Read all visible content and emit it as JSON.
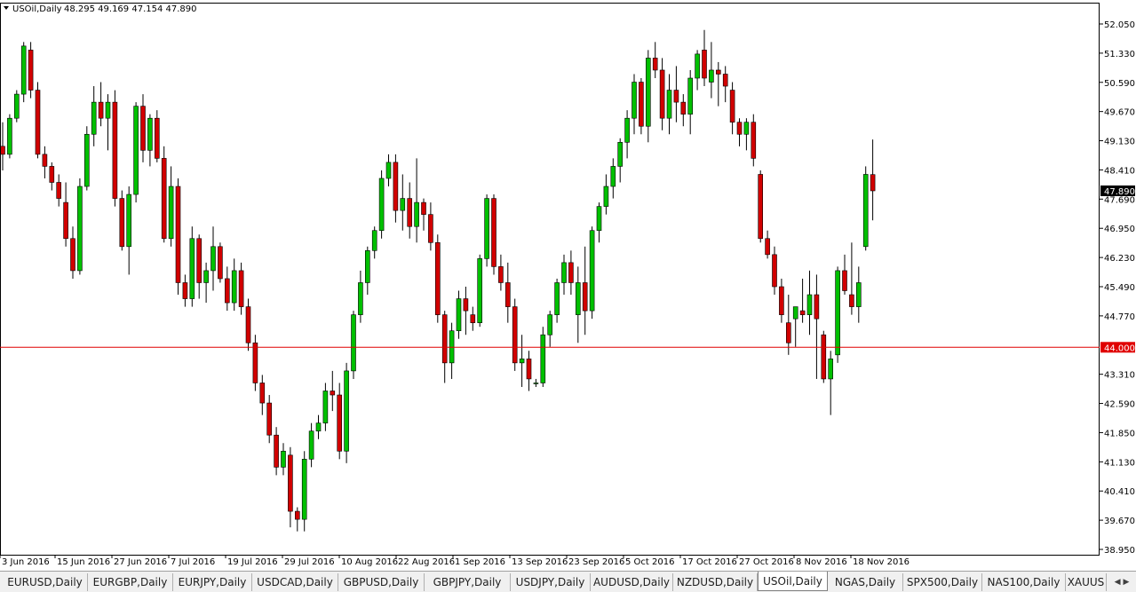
{
  "header": {
    "symbol": "USOil,Daily",
    "ohlc": "48.295 49.169 47.154 47.890"
  },
  "colors": {
    "bull": "#00c000",
    "bear": "#d10000",
    "wick": "#000000",
    "level_line": "#e00000",
    "price_tag_bg": "#000000",
    "level_tag_bg": "#e00000"
  },
  "chart_data": {
    "type": "candlestick",
    "title": "USOil,Daily",
    "y_ticks": [
      "52.050",
      "51.330",
      "50.590",
      "49.670",
      "49.130",
      "48.410",
      "47.690",
      "46.950",
      "46.230",
      "45.490",
      "44.770",
      "44.000",
      "43.310",
      "42.590",
      "41.850",
      "41.130",
      "40.410",
      "39.670",
      "38.950"
    ],
    "x_labels": [
      "3 Jun 2016",
      "15 Jun 2016",
      "27 Jun 2016",
      "7 Jul 2016",
      "19 Jul 2016",
      "29 Jul 2016",
      "10 Aug 2016",
      "22 Aug 2016",
      "1 Sep 2016",
      "13 Sep 2016",
      "23 Sep 2016",
      "5 Oct 2016",
      "17 Oct 2016",
      "27 Oct 2016",
      "8 Nov 2016",
      "18 Nov 2016"
    ],
    "ylim": [
      38.8,
      52.3
    ],
    "horizontal_line": {
      "value": 44.0,
      "label": "44.000"
    },
    "current_price": {
      "value": 47.89,
      "label": "47.890"
    },
    "candles": [
      [
        49.0,
        49.6,
        48.4,
        48.8
      ],
      [
        48.8,
        49.8,
        48.7,
        49.7
      ],
      [
        49.7,
        50.4,
        49.6,
        50.3
      ],
      [
        50.3,
        51.6,
        50.1,
        51.5
      ],
      [
        51.4,
        51.6,
        50.2,
        50.4
      ],
      [
        50.4,
        50.6,
        48.7,
        48.8
      ],
      [
        48.8,
        49.0,
        48.2,
        48.5
      ],
      [
        48.5,
        48.6,
        47.9,
        48.1
      ],
      [
        48.1,
        48.3,
        47.5,
        47.7
      ],
      [
        47.6,
        48.1,
        46.5,
        46.7
      ],
      [
        46.7,
        47.0,
        45.7,
        45.9
      ],
      [
        45.9,
        48.2,
        45.8,
        48.0
      ],
      [
        48.0,
        49.5,
        47.9,
        49.3
      ],
      [
        49.3,
        50.5,
        49.0,
        50.1
      ],
      [
        50.1,
        50.6,
        49.5,
        49.7
      ],
      [
        49.7,
        50.3,
        48.9,
        50.1
      ],
      [
        50.1,
        50.4,
        47.5,
        47.7
      ],
      [
        47.7,
        47.9,
        46.4,
        46.5
      ],
      [
        46.5,
        48.0,
        45.8,
        47.8
      ],
      [
        47.8,
        50.1,
        47.6,
        50.0
      ],
      [
        50.0,
        50.3,
        48.6,
        48.9
      ],
      [
        48.9,
        49.8,
        48.5,
        49.7
      ],
      [
        49.7,
        49.9,
        48.6,
        48.7
      ],
      [
        48.7,
        49.0,
        46.6,
        46.7
      ],
      [
        46.7,
        48.5,
        46.5,
        48.0
      ],
      [
        48.0,
        48.2,
        45.3,
        45.6
      ],
      [
        45.6,
        45.8,
        45.0,
        45.2
      ],
      [
        45.2,
        47.0,
        45.0,
        46.7
      ],
      [
        46.7,
        46.8,
        45.2,
        45.6
      ],
      [
        45.6,
        46.1,
        45.1,
        45.9
      ],
      [
        45.9,
        47.0,
        45.4,
        46.5
      ],
      [
        46.5,
        46.6,
        45.6,
        45.7
      ],
      [
        45.7,
        46.0,
        44.9,
        45.1
      ],
      [
        45.1,
        46.2,
        44.9,
        45.9
      ],
      [
        45.9,
        46.1,
        44.8,
        45.0
      ],
      [
        45.0,
        45.2,
        43.9,
        44.1
      ],
      [
        44.1,
        44.3,
        42.9,
        43.1
      ],
      [
        43.1,
        43.3,
        42.3,
        42.6
      ],
      [
        42.6,
        42.8,
        41.6,
        41.8
      ],
      [
        41.8,
        42.0,
        40.8,
        41.0
      ],
      [
        41.0,
        41.6,
        40.8,
        41.4
      ],
      [
        41.3,
        41.5,
        39.5,
        39.9
      ],
      [
        39.9,
        40.0,
        39.4,
        39.7
      ],
      [
        39.7,
        41.4,
        39.4,
        41.2
      ],
      [
        41.2,
        42.1,
        41.0,
        41.9
      ],
      [
        41.9,
        42.3,
        41.7,
        42.1
      ],
      [
        42.1,
        43.1,
        41.9,
        42.9
      ],
      [
        42.9,
        43.4,
        42.4,
        42.8
      ],
      [
        42.8,
        43.1,
        41.2,
        41.4
      ],
      [
        41.4,
        43.6,
        41.1,
        43.4
      ],
      [
        43.4,
        44.9,
        43.2,
        44.8
      ],
      [
        44.8,
        45.9,
        44.6,
        45.6
      ],
      [
        45.6,
        46.5,
        45.3,
        46.4
      ],
      [
        46.4,
        47.0,
        46.2,
        46.9
      ],
      [
        46.9,
        48.4,
        46.7,
        48.2
      ],
      [
        48.2,
        48.8,
        48.0,
        48.6
      ],
      [
        48.6,
        48.8,
        47.1,
        47.4
      ],
      [
        47.4,
        48.3,
        46.9,
        47.7
      ],
      [
        47.7,
        48.1,
        46.7,
        47.0
      ],
      [
        47.0,
        48.7,
        46.6,
        47.6
      ],
      [
        47.6,
        47.7,
        46.9,
        47.3
      ],
      [
        47.3,
        47.6,
        46.4,
        46.6
      ],
      [
        46.6,
        46.8,
        44.6,
        44.8
      ],
      [
        44.8,
        44.9,
        43.1,
        43.6
      ],
      [
        43.6,
        44.6,
        43.2,
        44.4
      ],
      [
        44.4,
        45.4,
        44.2,
        45.2
      ],
      [
        45.2,
        45.5,
        44.3,
        44.9
      ],
      [
        44.8,
        45.0,
        44.4,
        44.6
      ],
      [
        44.6,
        46.3,
        44.5,
        46.2
      ],
      [
        46.2,
        47.8,
        46.0,
        47.7
      ],
      [
        47.7,
        47.8,
        45.8,
        46.0
      ],
      [
        46.0,
        46.3,
        45.4,
        45.6
      ],
      [
        45.6,
        46.1,
        44.6,
        45.0
      ],
      [
        45.0,
        45.2,
        43.4,
        43.6
      ],
      [
        43.6,
        44.3,
        43.0,
        43.7
      ],
      [
        43.7,
        43.9,
        42.9,
        43.2
      ],
      [
        43.1,
        43.2,
        43.0,
        43.1
      ],
      [
        43.1,
        44.5,
        43.0,
        44.3
      ],
      [
        44.3,
        44.9,
        44.0,
        44.8
      ],
      [
        44.8,
        45.7,
        44.6,
        45.6
      ],
      [
        45.6,
        46.3,
        45.3,
        46.1
      ],
      [
        46.1,
        46.4,
        45.3,
        45.6
      ],
      [
        44.8,
        46.0,
        44.1,
        45.6
      ],
      [
        45.6,
        46.5,
        44.3,
        44.9
      ],
      [
        44.9,
        47.0,
        44.7,
        46.9
      ],
      [
        46.9,
        47.6,
        46.6,
        47.5
      ],
      [
        47.5,
        48.3,
        47.3,
        48.0
      ],
      [
        48.0,
        48.7,
        47.7,
        48.5
      ],
      [
        48.5,
        49.2,
        48.1,
        49.1
      ],
      [
        49.1,
        49.9,
        48.7,
        49.7
      ],
      [
        49.7,
        50.8,
        49.3,
        50.6
      ],
      [
        50.6,
        50.7,
        49.3,
        49.5
      ],
      [
        49.5,
        51.4,
        49.1,
        51.2
      ],
      [
        51.2,
        51.6,
        50.7,
        50.9
      ],
      [
        50.9,
        51.2,
        49.4,
        49.7
      ],
      [
        49.7,
        50.8,
        49.3,
        50.4
      ],
      [
        50.4,
        51.0,
        49.6,
        50.1
      ],
      [
        50.1,
        50.3,
        49.5,
        49.8
      ],
      [
        49.8,
        50.9,
        49.3,
        50.7
      ],
      [
        50.7,
        51.4,
        50.4,
        51.3
      ],
      [
        51.4,
        51.9,
        50.5,
        50.7
      ],
      [
        50.6,
        51.6,
        50.2,
        50.9
      ],
      [
        50.9,
        51.1,
        50.0,
        50.8
      ],
      [
        50.8,
        51.0,
        50.1,
        50.5
      ],
      [
        50.4,
        50.6,
        49.3,
        49.6
      ],
      [
        49.6,
        49.7,
        49.0,
        49.3
      ],
      [
        49.3,
        49.7,
        48.9,
        49.6
      ],
      [
        49.6,
        49.8,
        48.5,
        48.7
      ],
      [
        48.3,
        48.4,
        46.6,
        46.7
      ],
      [
        46.7,
        46.9,
        46.2,
        46.3
      ],
      [
        46.3,
        46.5,
        45.3,
        45.5
      ],
      [
        45.5,
        45.7,
        44.6,
        44.8
      ],
      [
        44.6,
        45.3,
        43.8,
        44.1
      ],
      [
        44.7,
        45.0,
        44.0,
        45.0
      ],
      [
        44.9,
        45.7,
        44.6,
        44.8
      ],
      [
        44.8,
        45.9,
        44.3,
        45.3
      ],
      [
        45.3,
        45.8,
        43.2,
        44.7
      ],
      [
        44.3,
        44.4,
        43.1,
        43.2
      ],
      [
        43.2,
        43.9,
        42.3,
        43.7
      ],
      [
        43.8,
        46.0,
        43.6,
        45.9
      ],
      [
        45.9,
        46.3,
        45.3,
        45.4
      ],
      [
        45.3,
        46.6,
        44.8,
        45.0
      ],
      [
        45.0,
        46.0,
        44.6,
        45.6
      ],
      [
        46.5,
        48.5,
        46.4,
        48.3
      ],
      [
        48.295,
        49.169,
        47.154,
        47.89
      ]
    ]
  },
  "tabs": [
    {
      "label": "EURUSD,Daily",
      "active": false
    },
    {
      "label": "EURGBP,Daily",
      "active": false
    },
    {
      "label": "EURJPY,Daily",
      "active": false
    },
    {
      "label": "USDCAD,Daily",
      "active": false
    },
    {
      "label": "GBPUSD,Daily",
      "active": false
    },
    {
      "label": "GBPJPY,Daily",
      "active": false
    },
    {
      "label": "USDJPY,Daily",
      "active": false
    },
    {
      "label": "AUDUSD,Daily",
      "active": false
    },
    {
      "label": "NZDUSD,Daily",
      "active": false
    },
    {
      "label": "USOil,Daily",
      "active": true
    },
    {
      "label": "NGAS,Daily",
      "active": false
    },
    {
      "label": "SPX500,Daily",
      "active": false
    },
    {
      "label": "NAS100,Daily",
      "active": false
    },
    {
      "label": "XAUUS",
      "active": false
    }
  ],
  "tab_scroll": {
    "left_icon": "arrow-left-icon",
    "right_icon": "arrow-right-icon"
  }
}
